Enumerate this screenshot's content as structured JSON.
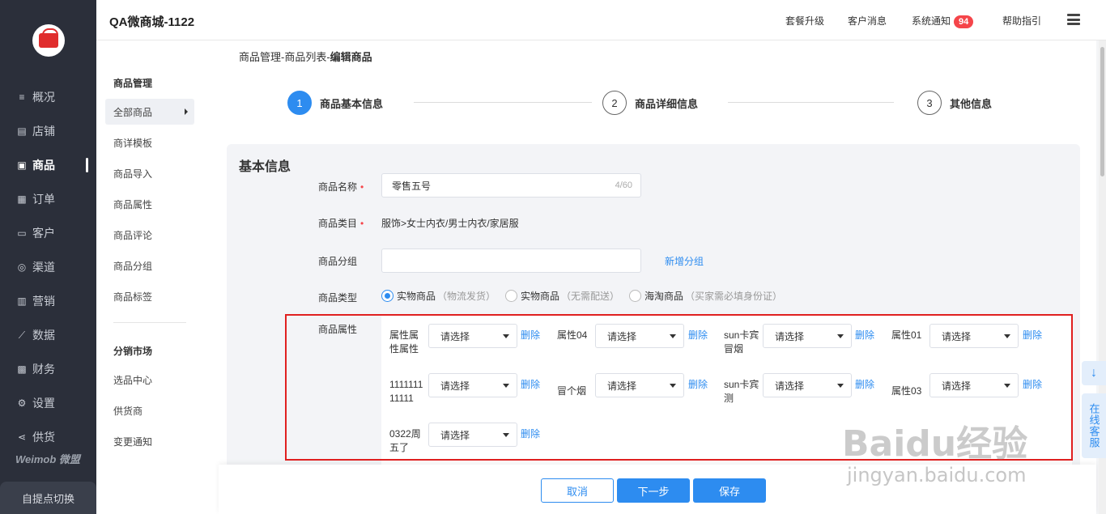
{
  "app": {
    "title": "QA微商城-1122",
    "brand": "Weimob 微盟",
    "switch_label": "自提点切换"
  },
  "topnav": {
    "upgrade": "套餐升级",
    "messages": "客户消息",
    "notice": "系统通知",
    "notice_count": "94",
    "help": "帮助指引"
  },
  "sidebar": {
    "items": [
      {
        "label": "概况",
        "icon": "list-icon"
      },
      {
        "label": "店铺",
        "icon": "store-icon"
      },
      {
        "label": "商品",
        "icon": "product-icon",
        "active": true
      },
      {
        "label": "订单",
        "icon": "order-icon"
      },
      {
        "label": "客户",
        "icon": "customer-icon"
      },
      {
        "label": "渠道",
        "icon": "channel-icon"
      },
      {
        "label": "营销",
        "icon": "marketing-icon"
      },
      {
        "label": "数据",
        "icon": "data-icon"
      },
      {
        "label": "财务",
        "icon": "finance-icon"
      },
      {
        "label": "设置",
        "icon": "settings-icon"
      },
      {
        "label": "供货",
        "icon": "supply-icon"
      }
    ]
  },
  "subnav": {
    "group1": "商品管理",
    "items1": [
      "全部商品",
      "商详模板",
      "商品导入",
      "商品属性",
      "商品评论",
      "商品分组",
      "商品标签"
    ],
    "group2": "分销市场",
    "items2": [
      "选品中心",
      "供货商",
      "变更通知"
    ]
  },
  "breadcrumb": {
    "part1": "商品管理-商品列表-",
    "part2": "编辑商品"
  },
  "steps": [
    {
      "num": "1",
      "label": "商品基本信息",
      "active": true
    },
    {
      "num": "2",
      "label": "商品详细信息",
      "active": false
    },
    {
      "num": "3",
      "label": "其他信息",
      "active": false
    }
  ],
  "form": {
    "section_title": "基本信息",
    "name_label": "商品名称",
    "name_value": "零售五号",
    "name_count": "4/60",
    "category_label": "商品类目",
    "category_value": "服饰>女士内衣/男士内衣/家居服",
    "group_label": "商品分组",
    "group_value": "",
    "group_link": "新增分组",
    "type_label": "商品类型",
    "type_options": [
      {
        "label": "实物商品",
        "hint": "（物流发货）",
        "selected": true
      },
      {
        "label": "实物商品",
        "hint": "（无需配送）",
        "selected": false
      },
      {
        "label": "海淘商品",
        "hint": "（买家需必填身份证）",
        "selected": false
      }
    ],
    "attr_label": "商品属性",
    "attributes": [
      {
        "label": "属性属性属性",
        "value": "请选择",
        "action": "删除"
      },
      {
        "label": "属性04",
        "value": "请选择",
        "action": "删除"
      },
      {
        "label": "sun卡宾冒烟",
        "value": "请选择",
        "action": "删除"
      },
      {
        "label": "属性01",
        "value": "请选择",
        "action": "删除"
      },
      {
        "label": "111111111111",
        "value": "请选择",
        "action": "删除"
      },
      {
        "label": "冒个烟",
        "value": "请选择",
        "action": "删除"
      },
      {
        "label": "sun卡宾测",
        "value": "请选择",
        "action": "删除"
      },
      {
        "label": "属性03",
        "value": "请选择",
        "action": "删除"
      },
      {
        "label": "0322周五了",
        "value": "请选择",
        "action": "删除"
      }
    ]
  },
  "footer": {
    "cancel": "取消",
    "next": "下一步",
    "save": "保存"
  },
  "floats": {
    "download": "↓",
    "service": "在线客服"
  },
  "watermark": {
    "main": "Baidu经验",
    "sub": "jingyan.baidu.com"
  },
  "colors": {
    "primary": "#2d8cf0",
    "sidebar": "#2b2f3a",
    "badge": "#f5454a",
    "highlight": "#e02020"
  }
}
